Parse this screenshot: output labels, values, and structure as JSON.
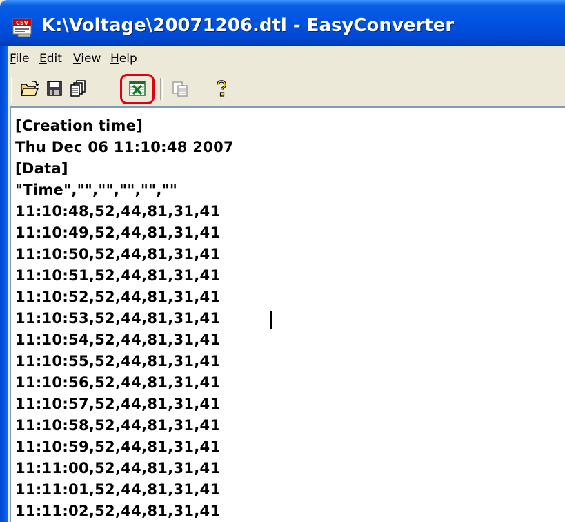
{
  "window": {
    "title": "K:\\Voltage\\20071206.dtl - EasyConverter",
    "app_icon": "csv-app-icon",
    "app_icon_label": "CSV"
  },
  "menu": {
    "items": [
      {
        "label_u": "F",
        "label_rest": "ile"
      },
      {
        "label_u": "E",
        "label_rest": "dit"
      },
      {
        "label_u": "V",
        "label_rest": "iew"
      },
      {
        "label_u": "H",
        "label_rest": "elp"
      }
    ]
  },
  "toolbar": {
    "buttons": [
      "open-folder-icon",
      "save-disk-icon",
      "copy-pages-icon",
      "excel-export-icon",
      "paste-icon",
      "help-question-icon"
    ],
    "highlighted": "excel-export-icon",
    "highlight_color": "#e0000f"
  },
  "content": {
    "lines": [
      "[Creation time]",
      "Thu Dec 06 11:10:48 2007",
      "[Data]",
      "\"Time\",\"\",\"\",\"\",\"\",\"\"",
      "11:10:48,52,44,81,31,41",
      "11:10:49,52,44,81,31,41",
      "11:10:50,52,44,81,31,41",
      "11:10:51,52,44,81,31,41",
      "11:10:52,52,44,81,31,41",
      "11:10:53,52,44,81,31,41",
      "11:10:54,52,44,81,31,41",
      "11:10:55,52,44,81,31,41",
      "11:10:56,52,44,81,31,41",
      "11:10:57,52,44,81,31,41",
      "11:10:58,52,44,81,31,41",
      "11:10:59,52,44,81,31,41",
      "11:11:00,52,44,81,31,41",
      "11:11:01,52,44,81,31,41",
      "11:11:02,52,44,81,31,41"
    ]
  },
  "colors": {
    "titlebar": "#0055e5",
    "background": "#ece9d8",
    "text_area": "#ffffff"
  }
}
